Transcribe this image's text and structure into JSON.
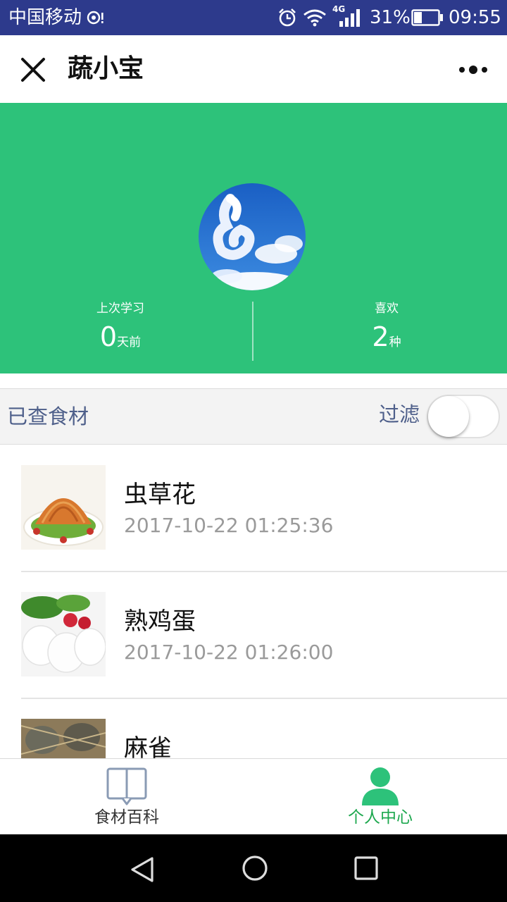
{
  "statusbar": {
    "carrier": "中国移动",
    "network": "4G",
    "battery": "31%",
    "time": "09:55"
  },
  "titlebar": {
    "title": "蔬小宝"
  },
  "profile": {
    "stats": [
      {
        "label": "上次学习",
        "value": "0",
        "unit": "天前"
      },
      {
        "label": "喜欢",
        "value": "2",
        "unit": "种"
      }
    ]
  },
  "section": {
    "title": "已查食材",
    "filter_label": "过滤",
    "filter_on": false
  },
  "list": {
    "items": [
      {
        "name": "虫草花",
        "time": "2017-10-22 01:25:36"
      },
      {
        "name": "熟鸡蛋",
        "time": "2017-10-22 01:26:00"
      },
      {
        "name": "麻雀",
        "time": ""
      }
    ]
  },
  "tabbar": {
    "tabs": [
      {
        "label": "食材百科",
        "active": false
      },
      {
        "label": "个人中心",
        "active": true
      }
    ]
  },
  "colors": {
    "brand_green": "#2dc27a",
    "active_tab_green": "#1ea84f",
    "status_bar": "#2d3a8c",
    "section_text": "#4e5f8a"
  }
}
